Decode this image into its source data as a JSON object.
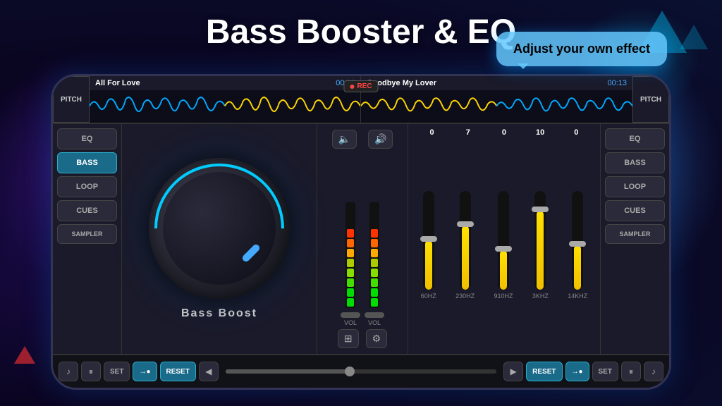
{
  "title": "Bass Booster & EQ",
  "tooltip": "Adjust your own effect",
  "topBar": {
    "pitchLabel": "PITCH",
    "leftTrack": {
      "name": "All For Love",
      "time": "00:11"
    },
    "recLabel": "REC",
    "rightTrack": {
      "name": "Goodbye My Lover",
      "time": "00:13"
    }
  },
  "leftPanel": {
    "buttons": [
      {
        "label": "EQ",
        "active": false
      },
      {
        "label": "BASS",
        "active": true
      },
      {
        "label": "LOOP",
        "active": false
      },
      {
        "label": "CUES",
        "active": false
      },
      {
        "label": "SAMPLER",
        "active": false
      }
    ]
  },
  "rightPanel": {
    "buttons": [
      {
        "label": "EQ",
        "active": false
      },
      {
        "label": "BASS",
        "active": false
      },
      {
        "label": "LOOP",
        "active": false
      },
      {
        "label": "CUES",
        "active": false
      },
      {
        "label": "SAMPLER",
        "active": false
      }
    ]
  },
  "knob": {
    "label": "Bass Boost"
  },
  "vuMeter": {
    "leftLabel": "VOL",
    "rightLabel": "VOL"
  },
  "eq": {
    "values": [
      "0",
      "7",
      "0",
      "10",
      "0"
    ],
    "frequencies": [
      "60HZ",
      "230HZ",
      "910HZ",
      "3KHZ",
      "14KHZ"
    ],
    "sliderPositions": [
      50,
      65,
      40,
      80,
      45
    ]
  },
  "transport": {
    "setLabel": "SET",
    "resetLabel": "RESET",
    "leftArrow": "◀",
    "rightArrow": "▶"
  },
  "icons": {
    "volumeDown": "🔈",
    "volumeUp": "🔊",
    "pause": "⏸",
    "music": "♪",
    "grid": "⊞",
    "settings": "⚙"
  }
}
